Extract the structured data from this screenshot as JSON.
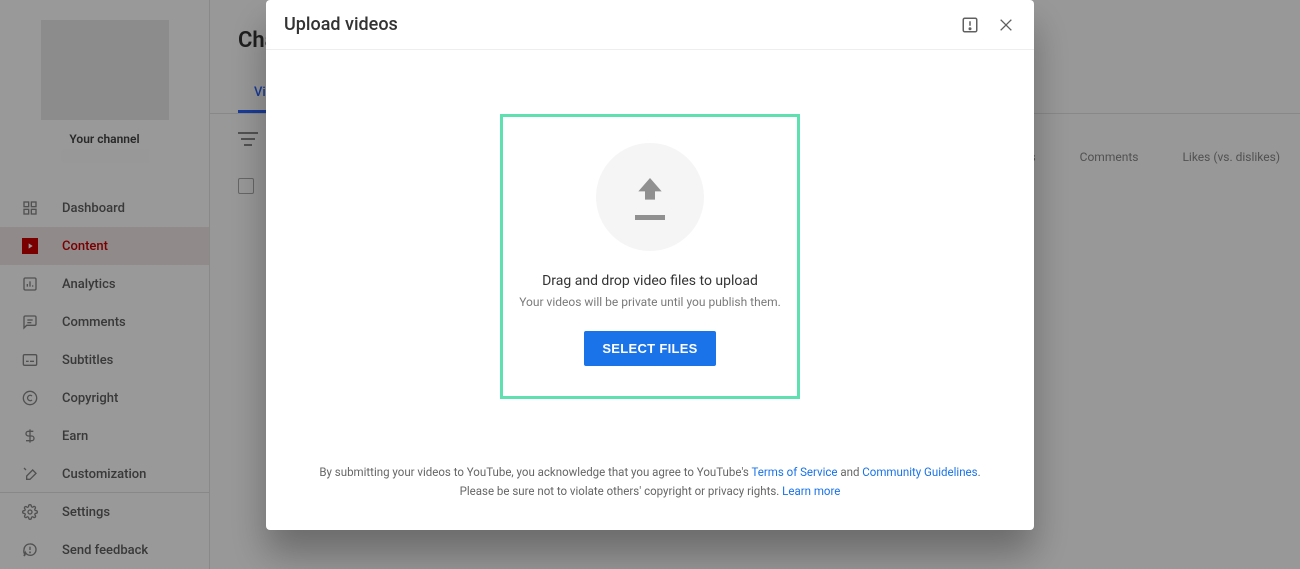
{
  "sidebar": {
    "channel_label": "Your channel",
    "items": [
      {
        "key": "dashboard",
        "label": "Dashboard"
      },
      {
        "key": "content",
        "label": "Content",
        "active": true
      },
      {
        "key": "analytics",
        "label": "Analytics"
      },
      {
        "key": "comments",
        "label": "Comments"
      },
      {
        "key": "subtitles",
        "label": "Subtitles"
      },
      {
        "key": "copyright",
        "label": "Copyright"
      },
      {
        "key": "earn",
        "label": "Earn"
      },
      {
        "key": "customization",
        "label": "Customization"
      }
    ],
    "footer_items": [
      {
        "key": "settings",
        "label": "Settings"
      },
      {
        "key": "feedback",
        "label": "Send feedback"
      }
    ]
  },
  "page": {
    "title_partial": "Cha",
    "tabs": [
      {
        "label": "Videos",
        "active": true
      }
    ],
    "columns": [
      "Views",
      "Comments",
      "Likes (vs. dislikes)"
    ]
  },
  "modal": {
    "title": "Upload videos",
    "drop_line1": "Drag and drop video files to upload",
    "drop_line2": "Your videos will be private until you publish them.",
    "select_button": "SELECT FILES",
    "legal_prefix": "By submitting your videos to YouTube, you acknowledge that you agree to YouTube's ",
    "tos": "Terms of Service",
    "and": " and ",
    "guidelines": "Community Guidelines",
    "legal_suffix": ".",
    "legal_line2_prefix": "Please be sure not to violate others' copyright or privacy rights. ",
    "learn_more": "Learn more"
  }
}
